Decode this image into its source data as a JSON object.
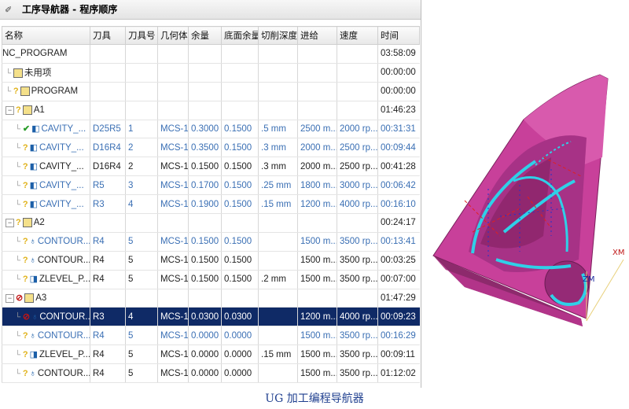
{
  "navigator": {
    "title": "工序导航器 - 程序顺序",
    "columns": [
      "名称",
      "刀具",
      "刀具号",
      "几何体",
      "余量",
      "底面余量",
      "切削深度",
      "进给",
      "速度",
      "时间"
    ],
    "rows": [
      {
        "name": "NC_PROGRAM",
        "tool": "",
        "tool_no": "",
        "geometry": "",
        "stock": "",
        "floor_stock": "",
        "depth": "",
        "feed": "",
        "speed": "",
        "time": "03:58:09",
        "style": "root",
        "icons": []
      },
      {
        "name": "未用项",
        "tool": "",
        "tool_no": "",
        "geometry": "",
        "stock": "",
        "floor_stock": "",
        "depth": "",
        "feed": "",
        "speed": "",
        "time": "00:00:00",
        "style": "normal",
        "icons": [
          "program-icon"
        ]
      },
      {
        "name": "PROGRAM",
        "tool": "",
        "tool_no": "",
        "geometry": "",
        "stock": "",
        "floor_stock": "",
        "depth": "",
        "feed": "",
        "speed": "",
        "time": "00:00:00",
        "style": "normal",
        "icons": [
          "key-icon",
          "program-icon"
        ]
      },
      {
        "name": "A1",
        "tool": "",
        "tool_no": "",
        "geometry": "",
        "stock": "",
        "floor_stock": "",
        "depth": "",
        "feed": "",
        "speed": "",
        "time": "01:46:23",
        "style": "group",
        "icons": [
          "key-icon",
          "program-icon"
        ]
      },
      {
        "name": "CAVITY_...",
        "tool": "D25R5",
        "tool_no": "1",
        "geometry": "MCS-1",
        "stock": "0.3000",
        "floor_stock": "0.1500",
        "depth": ".5 mm",
        "feed": "2500 m...",
        "speed": "2000 rp...",
        "time": "00:31:31",
        "style": "blue",
        "icons": [
          "check-icon",
          "cavity-op-icon"
        ]
      },
      {
        "name": "CAVITY_...",
        "tool": "D16R4",
        "tool_no": "2",
        "geometry": "MCS-1",
        "stock": "0.3500",
        "floor_stock": "0.1500",
        "depth": ".3 mm",
        "feed": "2000 m...",
        "speed": "2500 rp...",
        "time": "00:09:44",
        "style": "blue",
        "icons": [
          "key-icon",
          "cavity-op-icon"
        ]
      },
      {
        "name": "CAVITY_...",
        "tool": "D16R4",
        "tool_no": "2",
        "geometry": "MCS-1",
        "stock": "0.1500",
        "floor_stock": "0.1500",
        "depth": ".3 mm",
        "feed": "2000 m...",
        "speed": "2500 rp...",
        "time": "00:41:28",
        "style": "normal",
        "icons": [
          "key-icon",
          "cavity-op-icon"
        ]
      },
      {
        "name": "CAVITY_...",
        "tool": "R5",
        "tool_no": "3",
        "geometry": "MCS-1",
        "stock": "0.1700",
        "floor_stock": "0.1500",
        "depth": ".25 mm",
        "feed": "1800 m...",
        "speed": "3000 rp...",
        "time": "00:06:42",
        "style": "blue",
        "icons": [
          "key-icon",
          "cavity-op-icon"
        ]
      },
      {
        "name": "CAVITY_...",
        "tool": "R3",
        "tool_no": "4",
        "geometry": "MCS-1",
        "stock": "0.1900",
        "floor_stock": "0.1500",
        "depth": ".15 mm",
        "feed": "1200 m...",
        "speed": "4000 rp...",
        "time": "00:16:10",
        "style": "blue",
        "icons": [
          "key-icon",
          "cavity-op-icon"
        ]
      },
      {
        "name": "A2",
        "tool": "",
        "tool_no": "",
        "geometry": "",
        "stock": "",
        "floor_stock": "",
        "depth": "",
        "feed": "",
        "speed": "",
        "time": "00:24:17",
        "style": "group",
        "icons": [
          "key-icon",
          "program-icon"
        ]
      },
      {
        "name": "CONTOUR...",
        "tool": "R4",
        "tool_no": "5",
        "geometry": "MCS-1",
        "stock": "0.1500",
        "floor_stock": "0.1500",
        "depth": "",
        "feed": "1500 m...",
        "speed": "3500 rp...",
        "time": "00:13:41",
        "style": "blue",
        "icons": [
          "key-icon",
          "contour-op-icon"
        ]
      },
      {
        "name": "CONTOUR...",
        "tool": "R4",
        "tool_no": "5",
        "geometry": "MCS-1",
        "stock": "0.1500",
        "floor_stock": "0.1500",
        "depth": "",
        "feed": "1500 m...",
        "speed": "3500 rp...",
        "time": "00:03:25",
        "style": "normal",
        "icons": [
          "key-icon",
          "contour-op-icon"
        ]
      },
      {
        "name": "ZLEVEL_P...",
        "tool": "R4",
        "tool_no": "5",
        "geometry": "MCS-1",
        "stock": "0.1500",
        "floor_stock": "0.1500",
        "depth": ".2 mm",
        "feed": "1500 m...",
        "speed": "3500 rp...",
        "time": "00:07:00",
        "style": "normal",
        "icons": [
          "key-icon",
          "zlevel-op-icon"
        ]
      },
      {
        "name": "A3",
        "tool": "",
        "tool_no": "",
        "geometry": "",
        "stock": "",
        "floor_stock": "",
        "depth": "",
        "feed": "",
        "speed": "",
        "time": "01:47:29",
        "style": "group",
        "icons": [
          "no-entry-icon",
          "program-icon"
        ]
      },
      {
        "name": "CONTOUR...",
        "tool": "R3",
        "tool_no": "4",
        "geometry": "MCS-1",
        "stock": "0.0300",
        "floor_stock": "0.0300",
        "depth": "",
        "feed": "1200 m...",
        "speed": "4000 rp...",
        "time": "00:09:23",
        "style": "sel",
        "icons": [
          "no-entry-icon",
          "contour-op-icon"
        ]
      },
      {
        "name": "CONTOUR...",
        "tool": "R4",
        "tool_no": "5",
        "geometry": "MCS-1",
        "stock": "0.0000",
        "floor_stock": "0.0000",
        "depth": "",
        "feed": "1500 m...",
        "speed": "3500 rp...",
        "time": "00:16:29",
        "style": "blue",
        "icons": [
          "key-icon",
          "contour-op-icon"
        ]
      },
      {
        "name": "ZLEVEL_P...",
        "tool": "R4",
        "tool_no": "5",
        "geometry": "MCS-1",
        "stock": "0.0000",
        "floor_stock": "0.0000",
        "depth": ".15 mm",
        "feed": "1500 m...",
        "speed": "3500 rp...",
        "time": "00:09:11",
        "style": "normal",
        "icons": [
          "key-icon",
          "zlevel-op-icon"
        ]
      },
      {
        "name": "CONTOUR...",
        "tool": "R4",
        "tool_no": "5",
        "geometry": "MCS-1",
        "stock": "0.0000",
        "floor_stock": "0.0000",
        "depth": "",
        "feed": "1500 m...",
        "speed": "3500 rp...",
        "time": "01:12:02",
        "style": "normal",
        "icons": [
          "key-icon",
          "contour-op-icon"
        ]
      }
    ]
  },
  "view": {
    "axis_xm": "XM",
    "axis_zm": "ZM",
    "part_color": "#c8409a",
    "toolpath_color": "#2fd0e8"
  },
  "caption": "UG 加工编程导航器"
}
